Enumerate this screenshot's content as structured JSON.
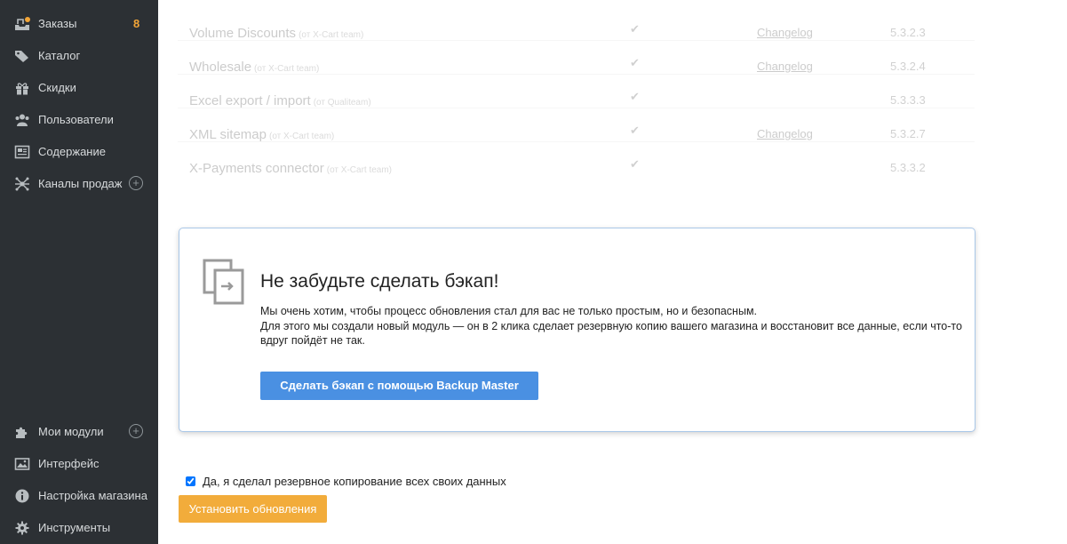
{
  "sidebar": {
    "items": [
      {
        "label": "Заказы",
        "icon": "orders-icon",
        "badge": "8"
      },
      {
        "label": "Каталог",
        "icon": "tag-icon"
      },
      {
        "label": "Скидки",
        "icon": "gift-icon"
      },
      {
        "label": "Пользователи",
        "icon": "users-icon"
      },
      {
        "label": "Содержание",
        "icon": "content-icon"
      },
      {
        "label": "Каналы продаж",
        "icon": "channels-icon",
        "plus": "+"
      }
    ],
    "bottom_items": [
      {
        "label": "Мои модули",
        "icon": "puzzle-icon",
        "plus": "+"
      },
      {
        "label": "Интерфейс",
        "icon": "image-icon"
      },
      {
        "label": "Настройка магазина",
        "icon": "info-icon"
      },
      {
        "label": "Инструменты",
        "icon": "gear-icon"
      }
    ],
    "badge_color": "#f3a537",
    "background": "#2c3034"
  },
  "modules": [
    {
      "name": "Volume Discounts",
      "author": "(от X-Cart team)",
      "installed": "✔",
      "link": "Changelog",
      "version": "5.3.2.3"
    },
    {
      "name": "Wholesale",
      "author": "(от X-Cart team)",
      "installed": "✔",
      "link": "Changelog",
      "version": "5.3.2.4"
    },
    {
      "name": "Excel export / import",
      "author": "(от Qualiteam)",
      "installed": "✔",
      "link": "",
      "version": "5.3.3.3"
    },
    {
      "name": "XML sitemap",
      "author": "(от X-Cart team)",
      "installed": "✔",
      "link": "Changelog",
      "version": "5.3.2.7"
    },
    {
      "name": "X-Payments connector",
      "author": "(от X-Cart team)",
      "installed": "✔",
      "link": "",
      "version": "5.3.3.2"
    }
  ],
  "backup_notice": {
    "icon": "copy-icon",
    "title": "Не забудьте сделать бэкап!",
    "line1": "Мы очень хотим, чтобы процесс обновления стал для вас не только простым, но и безопасным.",
    "line2": "Для этого мы создали новый модуль — он в 2 клика сделает резервную копию вашего магазина и восстановит все данные, если что-то вдруг пойдёт не так.",
    "button_label": "Сделать бэкап с помощью Backup Master",
    "button_color": "#4a90e2"
  },
  "confirm": {
    "checkbox_label": "Да, я сделал резервное копирование всех своих данных",
    "checked": true
  },
  "install_button": {
    "label": "Установить обновления",
    "color": "#f2ac3b"
  }
}
